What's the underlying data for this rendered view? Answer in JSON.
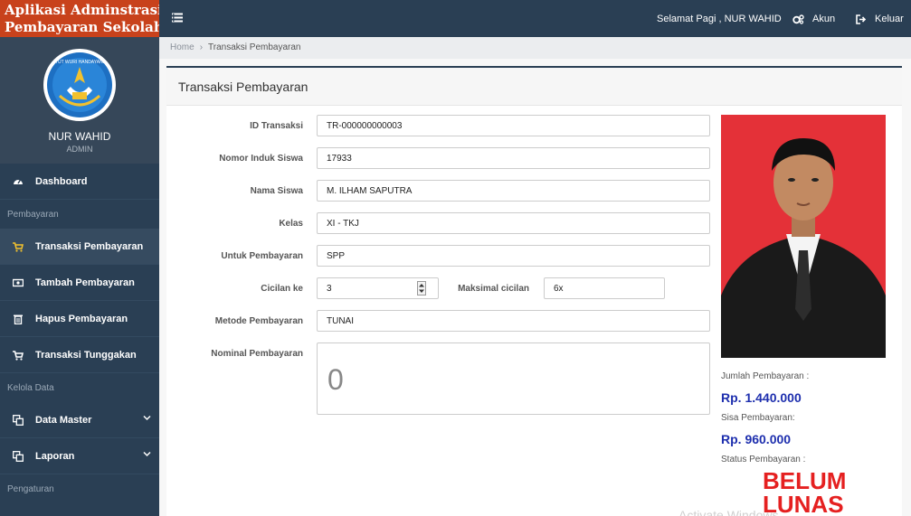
{
  "app": {
    "brand_line1": "Aplikasi Adminstrasi",
    "brand_line2": "Pembayaran Sekolah",
    "logo_text": "TUT WURI HANDAYANI"
  },
  "user": {
    "name": "NUR WAHID",
    "role": "ADMIN"
  },
  "topnav": {
    "greeting": "Selamat Pagi , NUR WAHID",
    "account_label": "Akun",
    "logout_label": "Keluar"
  },
  "sidebar": {
    "dashboard": "Dashboard",
    "section_pembayaran": "Pembayaran",
    "transaksi": "Transaksi Pembayaran",
    "tambah": "Tambah Pembayaran",
    "hapus": "Hapus Pembayaran",
    "tunggakan": "Transaksi Tunggakan",
    "section_kelola": "Kelola Data",
    "data_master": "Data Master",
    "laporan": "Laporan",
    "section_pengaturan": "Pengaturan"
  },
  "breadcrumb": {
    "home": "Home",
    "current": "Transaksi Pembayaran"
  },
  "panel": {
    "title": "Transaksi Pembayaran"
  },
  "form": {
    "id_label": "ID Transaksi",
    "id_value": "TR-000000000003",
    "nis_label": "Nomor Induk Siswa",
    "nis_value": "17933",
    "nama_label": "Nama Siswa",
    "nama_value": "M. ILHAM SAPUTRA",
    "kelas_label": "Kelas",
    "kelas_value": "XI - TKJ",
    "untuk_label": "Untuk Pembayaran",
    "untuk_value": "SPP",
    "cicilan_label": "Cicilan ke",
    "cicilan_value": "3",
    "maks_label": "Maksimal cicilan",
    "maks_value": "6x",
    "metode_label": "Metode Pembayaran",
    "metode_value": "TUNAI",
    "nominal_label": "Nominal Pembayaran",
    "nominal_value": "0"
  },
  "summary": {
    "jumlah_label": "Jumlah Pembayaran :",
    "jumlah_value": "Rp. 1.440.000",
    "sisa_label": "Sisa Pembayaran:",
    "sisa_value": "Rp. 960.000",
    "status_label": "Status Pembayaran :",
    "status_value": "BELUM LUNAS"
  },
  "watermark": "Activate Windows",
  "colors": {
    "sidebar_bg": "#2a3f54",
    "brand_bg": "#c8421c",
    "money_blue": "#1e2fae",
    "status_red": "#e52020",
    "photo_bg": "#e43138"
  },
  "icons": {
    "toggle": "menu-bars-icon",
    "account": "cogs-icon",
    "logout": "sign-out-icon",
    "dashboard": "gauge-icon",
    "cart": "cart-icon",
    "money": "money-icon",
    "trash": "trash-icon",
    "clone": "clone-icon",
    "chevron": "chevron-down-icon"
  }
}
